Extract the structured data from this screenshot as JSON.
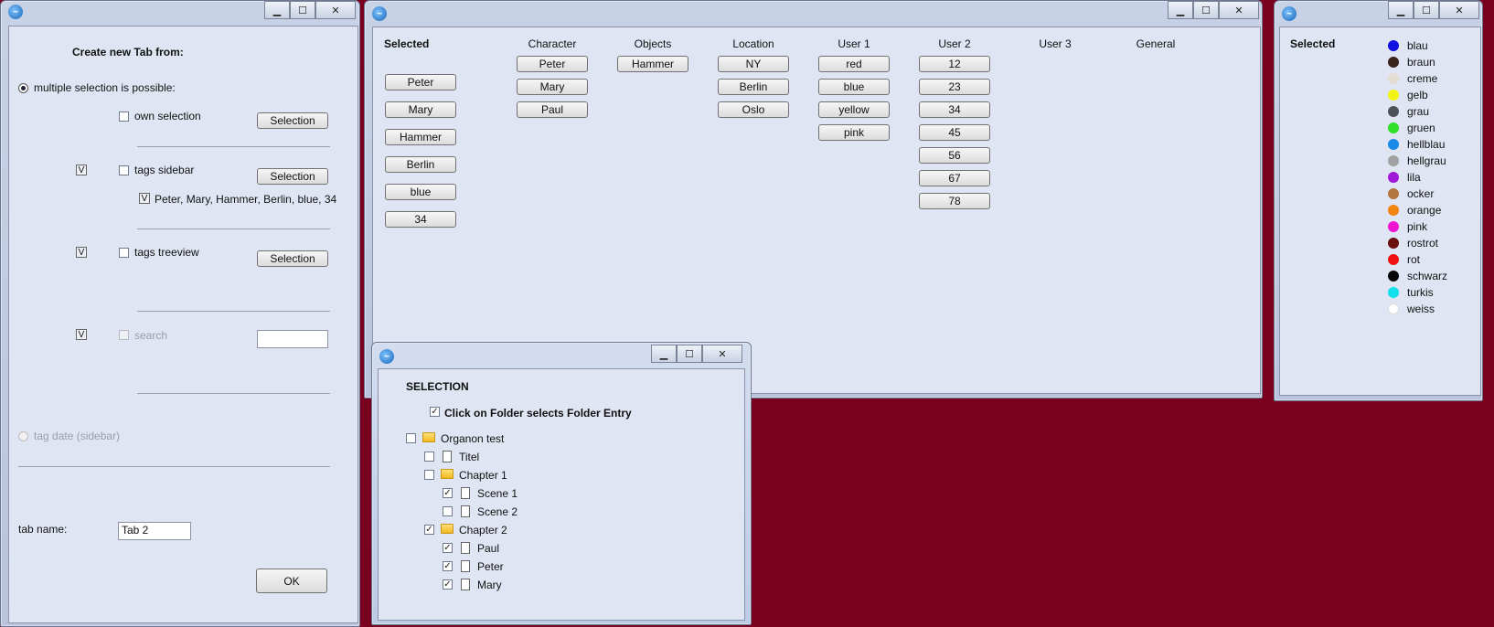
{
  "create_window": {
    "heading": "Create new Tab from:",
    "multi_label": "multiple selection is possible:",
    "own_selection_label": "own selection",
    "selection_btn": "Selection",
    "v_mark": "V",
    "tags_sidebar_label": "tags sidebar",
    "tags_sidebar_list": "Peter, Mary, Hammer, Berlin, blue, 34",
    "tags_treeview_label": "tags treeview",
    "search_label": "search",
    "search_value": "",
    "tag_date_label": "tag date (sidebar)",
    "tab_name_label": "tab name:",
    "tab_name_value": "Tab 2",
    "ok_btn": "OK"
  },
  "main_window": {
    "selected_header": "Selected",
    "selected_items": [
      "Peter",
      "Mary",
      "Hammer",
      "Berlin",
      "blue",
      "34"
    ],
    "columns": [
      {
        "header": "Character",
        "items": [
          "Peter",
          "Mary",
          "Paul"
        ]
      },
      {
        "header": "Objects",
        "items": [
          "Hammer"
        ]
      },
      {
        "header": "Location",
        "items": [
          "NY",
          "Berlin",
          "Oslo"
        ]
      },
      {
        "header": "User 1",
        "items": [
          "red",
          "blue",
          "yellow",
          "pink"
        ]
      },
      {
        "header": "User 2",
        "items": [
          "12",
          "23",
          "34",
          "45",
          "56",
          "67",
          "78"
        ]
      },
      {
        "header": "User 3",
        "items": []
      },
      {
        "header": "General",
        "items": []
      }
    ]
  },
  "color_window": {
    "selected_header": "Selected",
    "colors": [
      {
        "name": "blau",
        "hex": "#1010e0"
      },
      {
        "name": "braun",
        "hex": "#3a2218"
      },
      {
        "name": "creme",
        "hex": "#e3dcd0"
      },
      {
        "name": "gelb",
        "hex": "#f4f411"
      },
      {
        "name": "grau",
        "hex": "#4e5258"
      },
      {
        "name": "gruen",
        "hex": "#2ee02a"
      },
      {
        "name": "hellblau",
        "hex": "#1a8ae6"
      },
      {
        "name": "hellgrau",
        "hex": "#a0a0a0"
      },
      {
        "name": "lila",
        "hex": "#a218d8"
      },
      {
        "name": "ocker",
        "hex": "#b07840"
      },
      {
        "name": "orange",
        "hex": "#f28412"
      },
      {
        "name": "pink",
        "hex": "#f012d2"
      },
      {
        "name": "rostrot",
        "hex": "#6a0e0e"
      },
      {
        "name": "rot",
        "hex": "#ee1212"
      },
      {
        "name": "schwarz",
        "hex": "#080808"
      },
      {
        "name": "turkis",
        "hex": "#12e0ea"
      },
      {
        "name": "weiss",
        "hex": "#ffffff"
      }
    ]
  },
  "selection_window": {
    "heading": "SELECTION",
    "folder_option": "Click on Folder selects Folder Entry",
    "check_mark": "✓",
    "tree": [
      {
        "label": "Organon test",
        "type": "folder",
        "level": 0,
        "checked": false
      },
      {
        "label": "Titel",
        "type": "file",
        "level": 1,
        "checked": false
      },
      {
        "label": "Chapter 1",
        "type": "folder",
        "level": 1,
        "checked": false
      },
      {
        "label": "Scene 1",
        "type": "file",
        "level": 2,
        "checked": true
      },
      {
        "label": "Scene 2",
        "type": "file",
        "level": 2,
        "checked": false
      },
      {
        "label": "Chapter 2",
        "type": "folder",
        "level": 1,
        "checked": true
      },
      {
        "label": "Paul",
        "type": "file",
        "level": 2,
        "checked": true
      },
      {
        "label": "Peter",
        "type": "file",
        "level": 2,
        "checked": true
      },
      {
        "label": "Mary",
        "type": "file",
        "level": 2,
        "checked": true
      }
    ]
  },
  "title_buttons": {
    "minimize": "▁",
    "maximize": "☐",
    "close": "✕"
  }
}
